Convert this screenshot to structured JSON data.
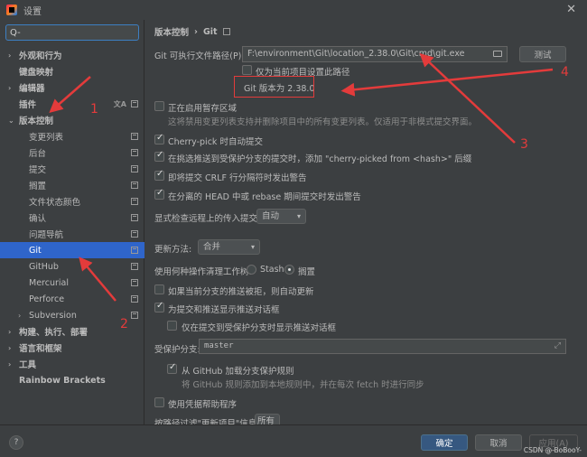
{
  "window": {
    "title": "设置"
  },
  "sidebar": {
    "search_value": "Q-",
    "items": [
      {
        "label": "外观和行为",
        "bold": true,
        "arrow": "›"
      },
      {
        "label": "键盘映射",
        "bold": true,
        "arrow": ""
      },
      {
        "label": "编辑器",
        "bold": true,
        "arrow": "›"
      },
      {
        "label": "插件",
        "bold": true,
        "arrow": ""
      },
      {
        "label": "版本控制",
        "bold": true,
        "arrow": "⌄"
      },
      {
        "label": "变更列表",
        "bold": false,
        "arrow": ""
      },
      {
        "label": "后台",
        "bold": false,
        "arrow": ""
      },
      {
        "label": "提交",
        "bold": false,
        "arrow": ""
      },
      {
        "label": "搁置",
        "bold": false,
        "arrow": ""
      },
      {
        "label": "文件状态颜色",
        "bold": false,
        "arrow": ""
      },
      {
        "label": "确认",
        "bold": false,
        "arrow": ""
      },
      {
        "label": "问题导航",
        "bold": false,
        "arrow": ""
      },
      {
        "label": "Git",
        "bold": false,
        "arrow": "",
        "selected": true
      },
      {
        "label": "GitHub",
        "bold": false,
        "arrow": ""
      },
      {
        "label": "Mercurial",
        "bold": false,
        "arrow": ""
      },
      {
        "label": "Perforce",
        "bold": false,
        "arrow": ""
      },
      {
        "label": "Subversion",
        "bold": false,
        "arrow": "›"
      },
      {
        "label": "构建、执行、部署",
        "bold": true,
        "arrow": "›"
      },
      {
        "label": "语言和框架",
        "bold": true,
        "arrow": "›"
      },
      {
        "label": "工具",
        "bold": true,
        "arrow": "›"
      },
      {
        "label": "Rainbow Brackets",
        "bold": true,
        "arrow": ""
      }
    ]
  },
  "breadcrumb": {
    "parent": "版本控制",
    "separator": "›",
    "current": "Git"
  },
  "git": {
    "path_label": "Git 可执行文件路径(P):",
    "path_value": "F:\\environment\\Git\\location_2.38.0\\Git\\cmd\\git.exe",
    "test_button": "测试",
    "project_only_label": "仅为当前项目设置此路径",
    "version_text": "Git 版本为 2.38.0",
    "staging_label": "正在启用暂存区域",
    "staging_hint": "这将禁用变更列表支持并删除项目中的所有变更列表。仅适用于非模式提交界面。",
    "cherry_pick_label": "Cherry-pick 时自动提交",
    "cherry_pick_suffix_label": "在挑选推送到受保护分支的提交时，添加 \"cherry-picked from <hash>\" 后缀",
    "crlf_label": "即将提交 CRLF 行分隔符时发出警告",
    "detached_head_label": "在分离的 HEAD 中或 rebase 期间提交时发出警告",
    "incoming_label": "显式检查远程上的传入提交:",
    "incoming_value": "自动",
    "update_method_label": "更新方法:",
    "update_method_value": "合并",
    "clean_tree_label": "使用何种操作清理工作树:",
    "stash_label": "Stash",
    "shelve_label": "搁置",
    "auto_update_label": "如果当前分支的推送被拒，则自动更新",
    "push_dialog_label": "为提交和推送显示推送对话框",
    "push_dialog_protected_label": "仅在提交到受保护分支时显示推送对话框",
    "protected_branches_label": "受保护分支:",
    "protected_branches_value": "master",
    "github_rules_label": "从 GitHub 加载分支保护规则",
    "github_rules_hint": "将 GitHub 规则添加到本地规则中，并在每次 fetch 时进行同步",
    "credential_helper_label": "使用凭据帮助程序",
    "filter_label": "按路径过滤\"更新项目\"信息:",
    "filter_value": "所有"
  },
  "footer": {
    "ok": "确定",
    "cancel": "取消",
    "apply": "应用(A)",
    "help": "?",
    "watermark": "CSDN @-BoBooY-"
  },
  "annotations": [
    "1",
    "2",
    "3",
    "4"
  ],
  "colors": {
    "accent": "#2f65ca",
    "primary_button": "#365880",
    "annotation": "#e33b3b",
    "background": "#3c3f41"
  }
}
